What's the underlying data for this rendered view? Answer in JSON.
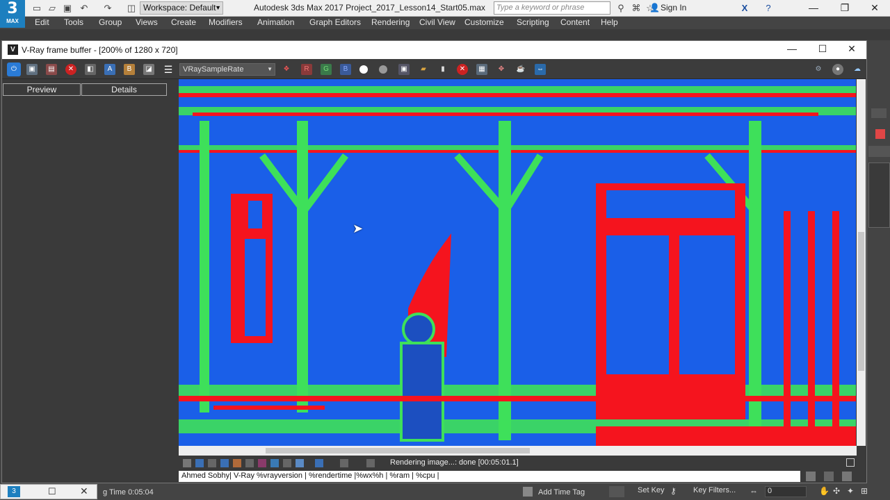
{
  "app": {
    "logo_number": "3",
    "logo_text": "MAX",
    "title": "Autodesk 3ds Max 2017    Project_2017_Lesson14_Start05.max",
    "workspace": "Workspace: Default",
    "search_placeholder": "Type a keyword or phrase",
    "sign_in": "Sign In"
  },
  "menu": [
    "Edit",
    "Tools",
    "Group",
    "Views",
    "Create",
    "Modifiers",
    "Animation",
    "Graph Editors",
    "Rendering",
    "Civil View",
    "Customize",
    "Scripting",
    "Content",
    "Help"
  ],
  "vfb": {
    "title": "V-Ray frame buffer - [200% of 1280 x 720]",
    "channel": "VRaySampleRate",
    "tabs": [
      "Preview",
      "Details"
    ],
    "status": "Rendering image...: done [00:05:01.1]",
    "stamp": "Ahmed Sobhy| V-Ray %vrayversion  | %rendertime |%wx%h |  %ram | %cpu |"
  },
  "bottom": {
    "time_label": "g Time  0:05:04",
    "add_time_tag": "Add Time Tag",
    "set_key": "Set Key",
    "key_filters": "Key Filters...",
    "frame": "0"
  },
  "colors": {
    "render_blue": "#1a5fe8",
    "render_red": "#f5141e",
    "render_green": "#3ee05a",
    "logo_blue": "#1d7fbf"
  }
}
